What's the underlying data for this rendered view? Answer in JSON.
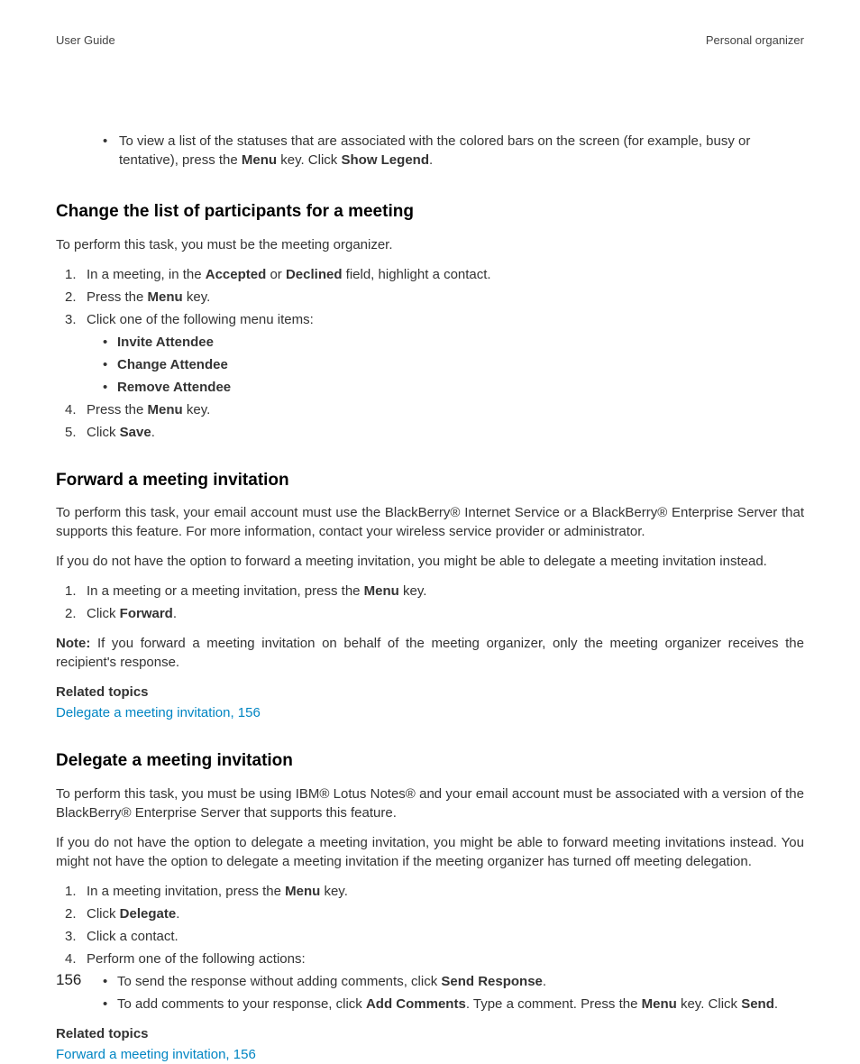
{
  "header": {
    "left": "User Guide",
    "right": "Personal organizer"
  },
  "topBullet": {
    "pre": "To view a list of the statuses that are associated with the colored bars on the screen (for example, busy or tentative), press the ",
    "b1": "Menu",
    "mid": " key. Click ",
    "b2": "Show Legend",
    "post": "."
  },
  "s1": {
    "title": "Change the list of participants for a meeting",
    "intro": "To perform this task, you must be the meeting organizer.",
    "step1": {
      "pre": "In a meeting, in the ",
      "b1": "Accepted",
      "mid1": " or ",
      "b2": "Declined",
      "post": " field, highlight a contact."
    },
    "step2": {
      "pre": "Press the ",
      "b1": "Menu",
      "post": " key."
    },
    "step3": {
      "text": "Click one of the following menu items:",
      "sub": [
        "Invite Attendee",
        "Change Attendee",
        "Remove Attendee"
      ]
    },
    "step4": {
      "pre": "Press the ",
      "b1": "Menu",
      "post": " key."
    },
    "step5": {
      "pre": "Click ",
      "b1": "Save",
      "post": "."
    }
  },
  "s2": {
    "title": "Forward a meeting invitation",
    "p1": "To perform this task, your email account must use the BlackBerry® Internet Service or a BlackBerry® Enterprise Server that supports this feature. For more information, contact your wireless service provider or administrator.",
    "p2": "If you do not have the option to forward a meeting invitation, you might be able to delegate a meeting invitation instead.",
    "step1": {
      "pre": "In a meeting or a meeting invitation, press the ",
      "b1": "Menu",
      "post": " key."
    },
    "step2": {
      "pre": "Click ",
      "b1": "Forward",
      "post": "."
    },
    "note": {
      "label": "Note:",
      "text": "  If you forward a meeting invitation on behalf of the meeting organizer, only the meeting organizer receives the recipient's response."
    },
    "related": {
      "label": "Related topics",
      "link": "Delegate a meeting invitation, 156"
    }
  },
  "s3": {
    "title": "Delegate a meeting invitation",
    "p1": "To perform this task, you must be using IBM® Lotus Notes® and your email account must be associated with a version of the BlackBerry® Enterprise Server that supports this feature.",
    "p2": "If you do not have the option to delegate a meeting invitation, you might be able to forward meeting invitations instead. You might not have the option to delegate a meeting invitation if the meeting organizer has turned off meeting delegation.",
    "step1": {
      "pre": "In a meeting invitation, press the ",
      "b1": "Menu",
      "post": " key."
    },
    "step2": {
      "pre": "Click ",
      "b1": "Delegate",
      "post": "."
    },
    "step3": "Click a contact.",
    "step4": {
      "text": "Perform one of the following actions:",
      "sub1": {
        "pre": "To send the response without adding comments, click ",
        "b1": "Send Response",
        "post": "."
      },
      "sub2": {
        "pre": "To add comments to your response, click ",
        "b1": "Add Comments",
        "mid": ". Type a comment. Press the ",
        "b2": "Menu",
        "mid2": " key. Click ",
        "b3": "Send",
        "post": "."
      }
    },
    "related": {
      "label": "Related topics",
      "link": "Forward a meeting invitation, 156"
    }
  },
  "pageNumber": "156"
}
